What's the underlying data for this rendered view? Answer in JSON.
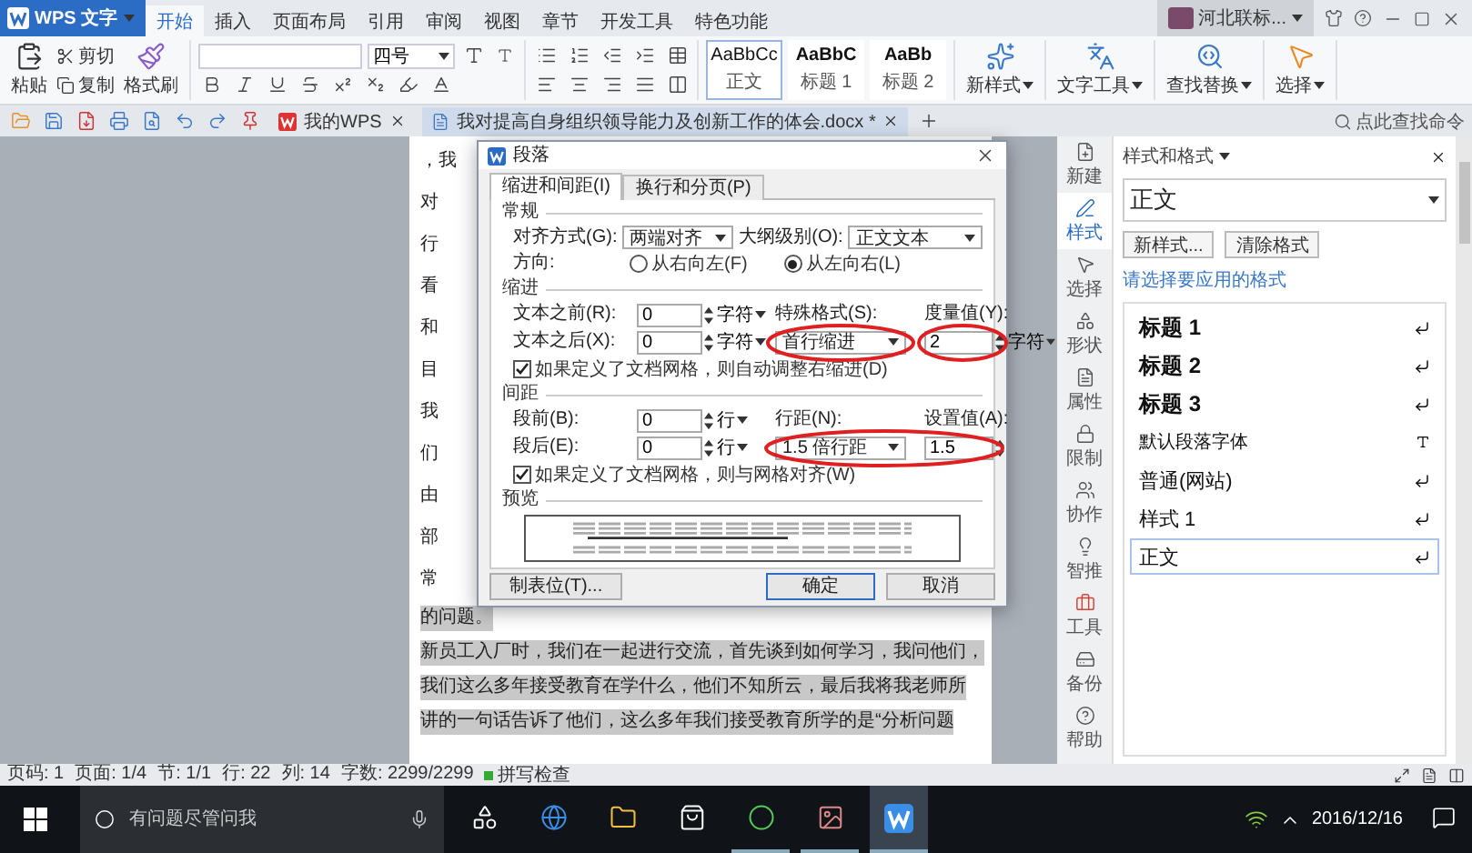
{
  "app_menu": {
    "label": "WPS 文字"
  },
  "ribbon_tabs": [
    {
      "label": "开始",
      "selected": true
    },
    {
      "label": "插入",
      "selected": false
    },
    {
      "label": "页面布局",
      "selected": false
    },
    {
      "label": "引用",
      "selected": false
    },
    {
      "label": "审阅",
      "selected": false
    },
    {
      "label": "视图",
      "selected": false
    },
    {
      "label": "章节",
      "selected": false
    },
    {
      "label": "开发工具",
      "selected": false
    },
    {
      "label": "特色功能",
      "selected": false
    }
  ],
  "account": {
    "name": "河北联标..."
  },
  "ribbon": {
    "clipboard": [
      "粘贴",
      "剪切",
      "复制",
      "格式刷"
    ],
    "font_size": "四号",
    "styles": [
      {
        "sample": "AaBbCc",
        "name": "正文",
        "selected": true
      },
      {
        "sample": "AaBbC",
        "name": "标题 1",
        "selected": false
      },
      {
        "sample": "AaBb",
        "name": "标题 2",
        "selected": false
      }
    ],
    "tools": [
      "新样式",
      "文字工具",
      "查找替换",
      "选择"
    ]
  },
  "doc_tabs": [
    {
      "label": "我的WPS",
      "selected": false
    },
    {
      "label": "我对提高自身组织领导能力及创新工作的体会.docx *",
      "selected": true
    }
  ],
  "command_search": {
    "placeholder": "点此查找命令"
  },
  "document": {
    "fragments": [
      "，我",
      "对",
      "行",
      "看",
      "和",
      "目",
      "我",
      "们",
      "由",
      "部",
      "常"
    ],
    "lines": [
      {
        "text": "的问题。",
        "selected": true
      },
      {
        "text": "新员工入厂时，我们在一起进行交流，首先谈到如何学习，我问他们，",
        "selected": true
      },
      {
        "text": "我们这么多年接受教育在学什么，他们不知所云，最后我将我老师所",
        "selected": true
      },
      {
        "text": "讲的一句话告诉了他们，这么多年我们接受教育所学的是“分析问题",
        "selected": true
      }
    ]
  },
  "dialog": {
    "title": "段落",
    "tabs": [
      {
        "label": "缩进和间距(I)",
        "selected": true
      },
      {
        "label": "换行和分页(P)",
        "selected": false
      }
    ],
    "general": {
      "heading": "常规",
      "alignment": {
        "label": "对齐方式(G):",
        "value": "两端对齐"
      },
      "outline": {
        "label": "大纲级别(O):",
        "value": "正文文本"
      },
      "direction": {
        "label": "方向:",
        "options": [
          {
            "label": "从右向左(F)",
            "selected": false
          },
          {
            "label": "从左向右(L)",
            "selected": true
          }
        ]
      }
    },
    "indent": {
      "heading": "缩进",
      "before": {
        "label": "文本之前(R):",
        "value": "0",
        "unit": "字符"
      },
      "after": {
        "label": "文本之后(X):",
        "value": "0",
        "unit": "字符"
      },
      "special": {
        "label": "特殊格式(S):",
        "value": "首行缩进"
      },
      "measure": {
        "label": "度量值(Y):",
        "value": "2",
        "unit": "字符"
      },
      "auto_adjust": {
        "label": "如果定义了文档网格，则自动调整右缩进(D)",
        "checked": true
      }
    },
    "spacing": {
      "heading": "间距",
      "before": {
        "label": "段前(B):",
        "value": "0",
        "unit": "行"
      },
      "after": {
        "label": "段后(E):",
        "value": "0",
        "unit": "行"
      },
      "line_spacing": {
        "label": "行距(N):",
        "value": "1.5 倍行距"
      },
      "set_value": {
        "label": "设置值(A):",
        "value": "1.5"
      },
      "snap_grid": {
        "label": "如果定义了文档网格，则与网格对齐(W)",
        "checked": true
      }
    },
    "preview": {
      "heading": "预览"
    },
    "buttons": {
      "tabs": "制表位(T)...",
      "ok": "确定",
      "cancel": "取消"
    }
  },
  "sidebar": {
    "items": [
      {
        "label": "新建",
        "selected": false
      },
      {
        "label": "样式",
        "selected": true
      },
      {
        "label": "选择",
        "selected": false
      },
      {
        "label": "形状",
        "selected": false
      },
      {
        "label": "属性",
        "selected": false
      },
      {
        "label": "限制",
        "selected": false
      },
      {
        "label": "协作",
        "selected": false
      },
      {
        "label": "智推",
        "selected": false
      },
      {
        "label": "工具",
        "selected": false
      },
      {
        "label": "备份",
        "selected": false
      },
      {
        "label": "帮助",
        "selected": false
      }
    ]
  },
  "styles_panel": {
    "title": "样式和格式",
    "current": "正文",
    "buttons": [
      "新样式...",
      "清除格式"
    ],
    "prompt": "请选择要应用的格式",
    "items": [
      {
        "label": "标题 1",
        "kind": "heading",
        "selected": false
      },
      {
        "label": "标题 2",
        "kind": "heading",
        "selected": false
      },
      {
        "label": "标题 3",
        "kind": "heading",
        "selected": false
      },
      {
        "label": "默认段落字体",
        "kind": "character",
        "selected": false
      },
      {
        "label": "普通(网站)",
        "kind": "paragraph",
        "selected": false
      },
      {
        "label": "样式 1",
        "kind": "paragraph",
        "selected": false
      },
      {
        "label": "正文",
        "kind": "paragraph",
        "selected": true
      }
    ]
  },
  "status_bar": {
    "items": [
      "页码: 1",
      "页面: 1/4",
      "节: 1/1",
      "行: 22",
      "列: 14",
      "字数: 2299/2299"
    ],
    "spell_check": "拼写检查"
  },
  "taskbar": {
    "search": {
      "placeholder": "有问题尽管问我"
    },
    "date": "2016/12/16"
  }
}
